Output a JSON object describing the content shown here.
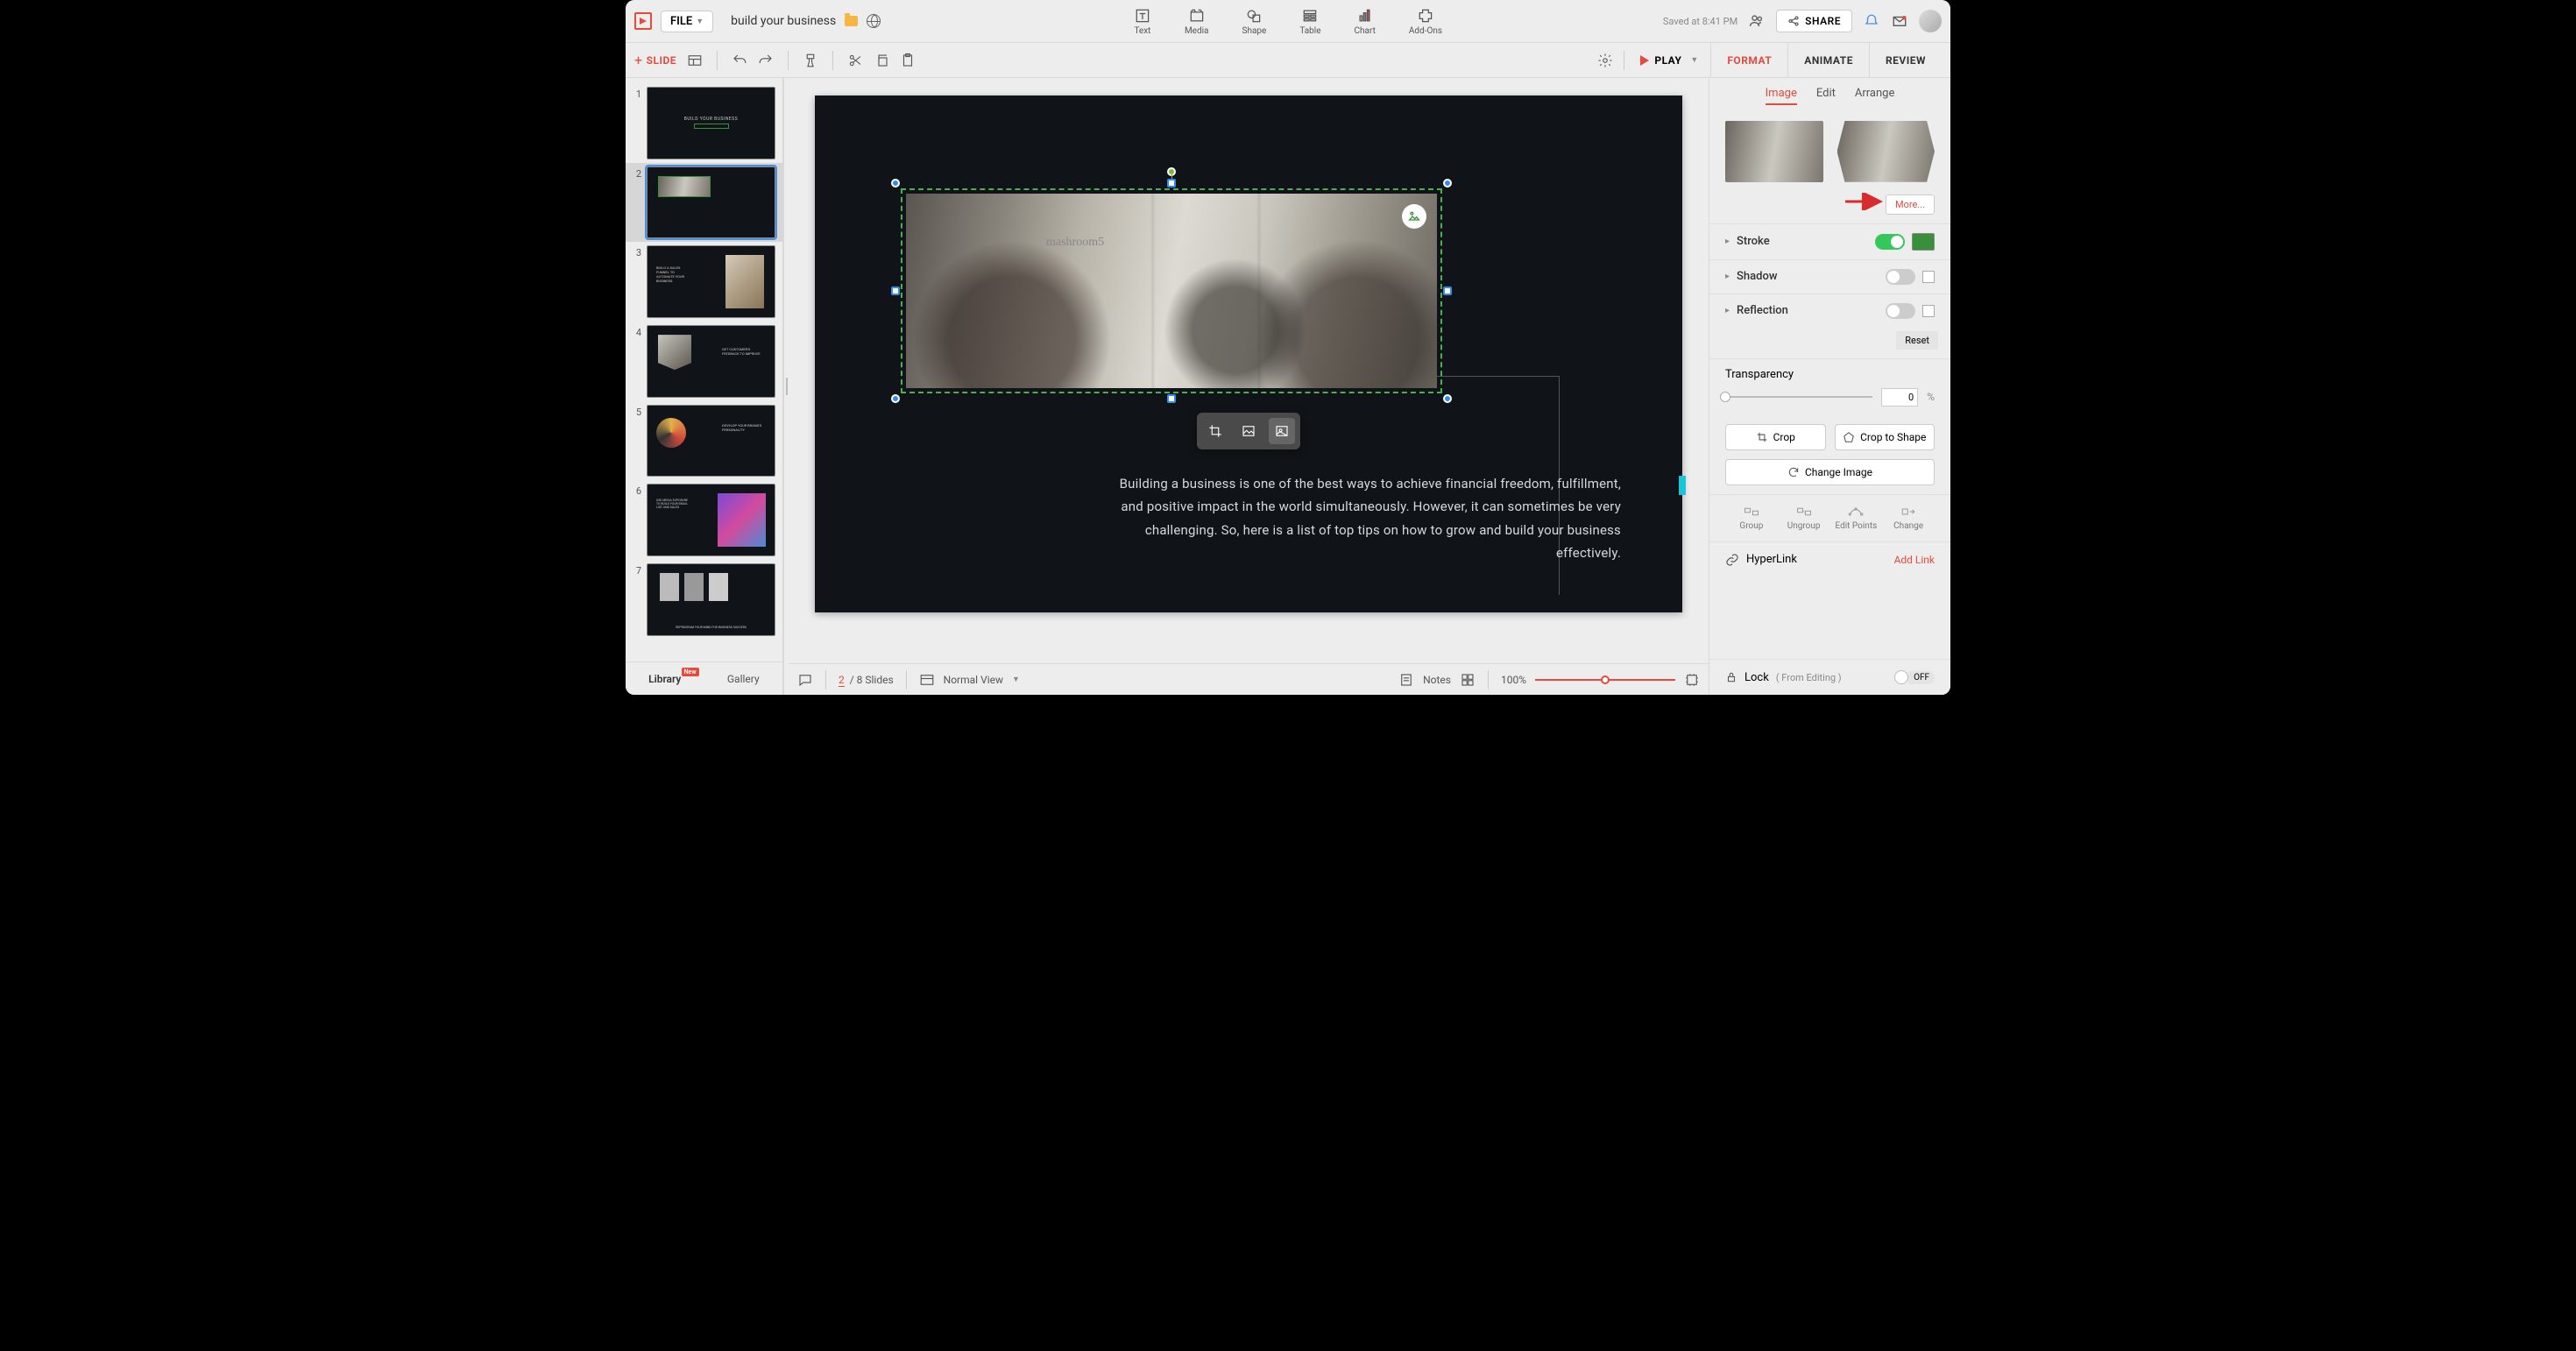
{
  "header": {
    "file_label": "FILE",
    "doc_title": "build your business",
    "saved_text": "Saved at 8:41 PM",
    "share_label": "SHARE"
  },
  "tools": {
    "text": "Text",
    "media": "Media",
    "shape": "Shape",
    "table": "Table",
    "chart": "Chart",
    "addons": "Add-Ons"
  },
  "secondbar": {
    "slide_label": "SLIDE",
    "play_label": "PLAY"
  },
  "tabs": {
    "format": "FORMAT",
    "animate": "ANIMATE",
    "review": "REVIEW"
  },
  "thumbs_footer": {
    "library": "Library",
    "library_badge": "New",
    "gallery": "Gallery"
  },
  "slide_numbers": [
    "1",
    "2",
    "3",
    "4",
    "5",
    "6",
    "7"
  ],
  "thumb_titles": [
    "BUILD YOUR BUSINESS",
    "",
    "BUILD A SALES FUNNEL TO AUTOMATE YOUR BUSINESS",
    "GET CUSTOMER'S FEEDBACK TO IMPROVE",
    "DEVELOP YOUR BRAND'S PERSONALITY",
    "USE MEDIA EXPOSURE TO BUILD YOUR EMAIL LIST AND SALES",
    "REPROGRAM YOUR MIND FOR BUSINESS SUCCESS"
  ],
  "slide": {
    "body_text": "Building  a business  is one of the best ways to achieve  financial  freedom,  fulfillment,  and positive  impact in the world simultaneously.  However, it can sometimes  be very challenging. So, here is a list of top tips on how to grow and build your business effectively.",
    "img_overlay_text": "mashroom5"
  },
  "footer": {
    "current_slide": "2",
    "total_slides": "8 Slides",
    "view_mode": "Normal View",
    "notes": "Notes",
    "zoom": "100%"
  },
  "panel": {
    "subtabs": {
      "image": "Image",
      "edit": "Edit",
      "arrange": "Arrange"
    },
    "more": "More...",
    "stroke": "Stroke",
    "shadow": "Shadow",
    "reflection": "Reflection",
    "reset": "Reset",
    "transparency": "Transparency",
    "transparency_value": "0",
    "crop": "Crop",
    "crop_to_shape": "Crop to Shape",
    "change_image": "Change Image",
    "group": "Group",
    "ungroup": "Ungroup",
    "edit_points": "Edit Points",
    "change": "Change",
    "hyperlink": "HyperLink",
    "add_link": "Add Link",
    "lock": "Lock",
    "lock_sub": "( From Editing )",
    "off": "OFF"
  }
}
